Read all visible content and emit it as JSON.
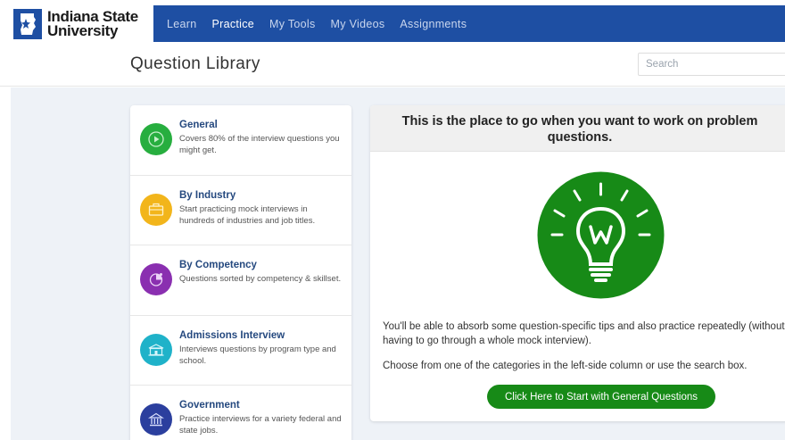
{
  "brand": {
    "line1": "Indiana State",
    "line2": "University",
    "color": "#1e4fa3"
  },
  "nav": {
    "items": [
      {
        "label": "Learn",
        "active": false
      },
      {
        "label": "Practice",
        "active": true
      },
      {
        "label": "My Tools",
        "active": false
      },
      {
        "label": "My Videos",
        "active": false
      },
      {
        "label": "Assignments",
        "active": false
      }
    ]
  },
  "header": {
    "title": "Question Library",
    "search_placeholder": "Search"
  },
  "categories": [
    {
      "title": "General",
      "desc": "Covers 80% of the interview questions you might get.",
      "icon": "play-icon",
      "color": "#27ae3f"
    },
    {
      "title": "By Industry",
      "desc": "Start practicing mock interviews in hundreds of industries and job titles.",
      "icon": "briefcase-icon",
      "color": "#f2b51b"
    },
    {
      "title": "By Competency",
      "desc": "Questions sorted by competency & skillset.",
      "icon": "competency-chart-icon",
      "color": "#8a2fb0"
    },
    {
      "title": "Admissions Interview",
      "desc": "Interviews questions by program type and school.",
      "icon": "school-icon",
      "color": "#1fb2c9"
    },
    {
      "title": "Government",
      "desc": "Practice interviews for a variety federal and state jobs.",
      "icon": "government-building-icon",
      "color": "#2b3f9e"
    }
  ],
  "panel": {
    "heading": "This is the place to go when you want to work on problem questions.",
    "para1": "You'll be able to absorb some question-specific tips and also practice repeatedly (without having to go through a whole mock interview).",
    "para2": "Choose from one of the categories in the left-side column or use the search box.",
    "cta": "Click Here to Start with General Questions",
    "bulb_color": "#178a17",
    "bulb_icon": "lightbulb-icon"
  }
}
